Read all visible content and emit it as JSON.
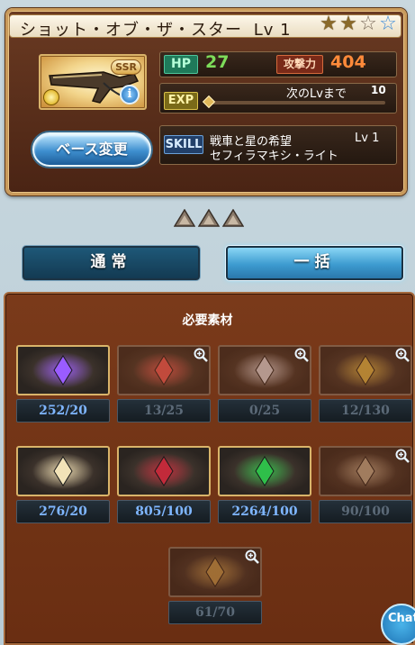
{
  "weapon": {
    "name": "ショット・オブ・ザ・スター",
    "level_label": "Lv 1",
    "rarity": "SSR",
    "stars": [
      "filled",
      "filled",
      "empty",
      "blue"
    ],
    "hp_label": "HP",
    "hp_value": "27",
    "atk_label": "攻撃力",
    "atk_value": "404",
    "exp_label": "EXP",
    "exp_next_label": "次のLvまで",
    "exp_next_value": "10",
    "exp_progress": 0.0,
    "skill_label": "SKILL",
    "skill_name": "戦車と星の希望",
    "skill_level": "Lv 1",
    "skill_name2": "セフィラマキシ・ライト",
    "base_change_label": "ベース変更",
    "info_icon": "i"
  },
  "uncap_count": 3,
  "modes": {
    "normal_label": "通常",
    "bulk_label": "一括",
    "selected": "bulk"
  },
  "materials_title": "必要素材",
  "materials": [
    {
      "count": "252/20",
      "status": "done",
      "icon": "purple-crystal-icon",
      "color": "#9a5cff"
    },
    {
      "count": "13/25",
      "status": "pending",
      "icon": "red-orb-icon",
      "color": "#ff5a5a"
    },
    {
      "count": "0/25",
      "status": "pending",
      "icon": "light-orb-icon",
      "color": "#e8e8f0"
    },
    {
      "count": "12/130",
      "status": "pending",
      "icon": "gold-quill-icon",
      "color": "#e6c24a"
    },
    {
      "count": "276/20",
      "status": "done",
      "icon": "feather-charm-icon",
      "color": "#f2e3b8"
    },
    {
      "count": "805/100",
      "status": "done",
      "icon": "red-scroll-icon",
      "color": "#c22a3a"
    },
    {
      "count": "2264/100",
      "status": "done",
      "icon": "green-scroll-icon",
      "color": "#2fbf4a"
    },
    {
      "count": "90/100",
      "status": "pending",
      "icon": "seal-medallion-icon",
      "color": "#c8b89a"
    },
    {
      "count": "61/70",
      "status": "pending",
      "icon": "star-emblem-icon",
      "color": "#c8a050"
    }
  ],
  "chat_label": "Chat",
  "colors": {
    "hp": "#7ddc5a",
    "atk": "#ff8a3a",
    "done_count": "#7fb6ff",
    "pending_count": "#5c6a78"
  }
}
